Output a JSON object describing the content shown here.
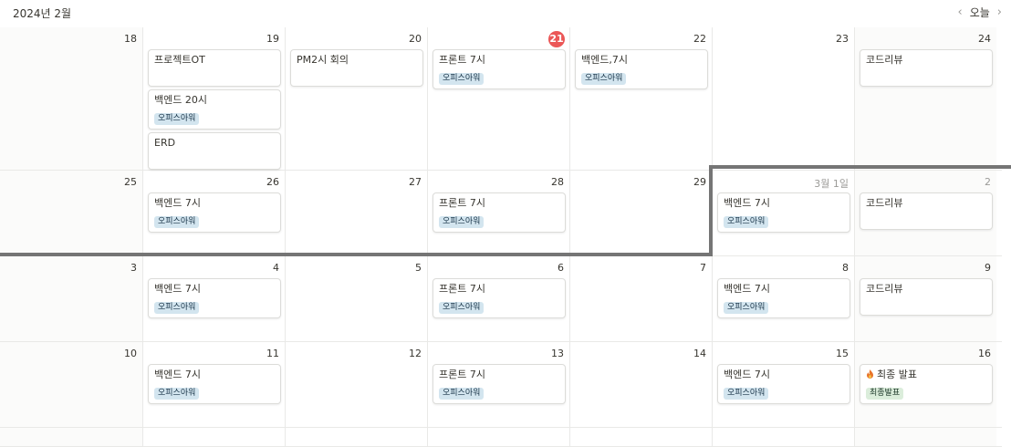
{
  "header": {
    "title": "2024년 2월",
    "today_label": "오늘",
    "prev_icon": "‹",
    "next_icon": "›"
  },
  "weeks": [
    {
      "days": [
        {
          "num": "18",
          "weekend": true,
          "events": []
        },
        {
          "num": "19",
          "events": [
            {
              "title": "프로젝트OT"
            },
            {
              "title": "백엔드 20시",
              "tag": "오피스아워"
            },
            {
              "title": "ERD"
            }
          ]
        },
        {
          "num": "20",
          "events": [
            {
              "title": "PM2시 회의"
            }
          ]
        },
        {
          "num": "21",
          "today": true,
          "events": [
            {
              "title": "프론트 7시",
              "tag": "오피스아워"
            }
          ]
        },
        {
          "num": "22",
          "events": [
            {
              "title": "백엔드,7시",
              "tag": "오피스아워"
            }
          ]
        },
        {
          "num": "23",
          "events": []
        },
        {
          "num": "24",
          "weekend": true,
          "events": [
            {
              "title": "코드리뷰"
            }
          ]
        }
      ]
    },
    {
      "days": [
        {
          "num": "25",
          "weekend": true,
          "events": []
        },
        {
          "num": "26",
          "events": [
            {
              "title": "백엔드 7시",
              "tag": "오피스아워"
            }
          ]
        },
        {
          "num": "27",
          "events": []
        },
        {
          "num": "28",
          "events": [
            {
              "title": "프론트 7시",
              "tag": "오피스아워"
            }
          ]
        },
        {
          "num": "29",
          "events": []
        },
        {
          "num": "3월 1일",
          "muted": true,
          "events": [
            {
              "title": "백엔드 7시",
              "tag": "오피스아워"
            }
          ]
        },
        {
          "num": "2",
          "muted": true,
          "weekend": true,
          "events": [
            {
              "title": "코드리뷰"
            }
          ]
        }
      ]
    },
    {
      "days": [
        {
          "num": "3",
          "weekend": true,
          "events": []
        },
        {
          "num": "4",
          "events": [
            {
              "title": "백엔드 7시",
              "tag": "오피스아워"
            }
          ]
        },
        {
          "num": "5",
          "events": []
        },
        {
          "num": "6",
          "events": [
            {
              "title": "프론트 7시",
              "tag": "오피스아워"
            }
          ]
        },
        {
          "num": "7",
          "events": []
        },
        {
          "num": "8",
          "events": [
            {
              "title": "백엔드 7시",
              "tag": "오피스아워"
            }
          ]
        },
        {
          "num": "9",
          "weekend": true,
          "events": [
            {
              "title": "코드리뷰"
            }
          ]
        }
      ]
    },
    {
      "days": [
        {
          "num": "10",
          "weekend": true,
          "events": []
        },
        {
          "num": "11",
          "events": [
            {
              "title": "백엔드 7시",
              "tag": "오피스아워"
            }
          ]
        },
        {
          "num": "12",
          "events": []
        },
        {
          "num": "13",
          "events": [
            {
              "title": "프론트 7시",
              "tag": "오피스아워"
            }
          ]
        },
        {
          "num": "14",
          "events": []
        },
        {
          "num": "15",
          "events": [
            {
              "title": "백엔드 7시",
              "tag": "오피스아워"
            }
          ]
        },
        {
          "num": "16",
          "weekend": true,
          "events": [
            {
              "title": "최종 발표",
              "icon": "fire-icon",
              "tag": "최종발표",
              "tag_color": "green"
            }
          ]
        }
      ]
    },
    {
      "days": [
        {
          "num": "",
          "weekend": true,
          "events": []
        },
        {
          "num": "",
          "events": []
        },
        {
          "num": "",
          "events": []
        },
        {
          "num": "",
          "events": []
        },
        {
          "num": "",
          "events": []
        },
        {
          "num": "",
          "events": []
        },
        {
          "num": "",
          "weekend": true,
          "events": []
        }
      ]
    }
  ],
  "colors": {
    "today": "#eb5757",
    "tag_blue": "#d3e5ef",
    "tag_green": "#dbeddb",
    "month_divider": "#757575"
  }
}
